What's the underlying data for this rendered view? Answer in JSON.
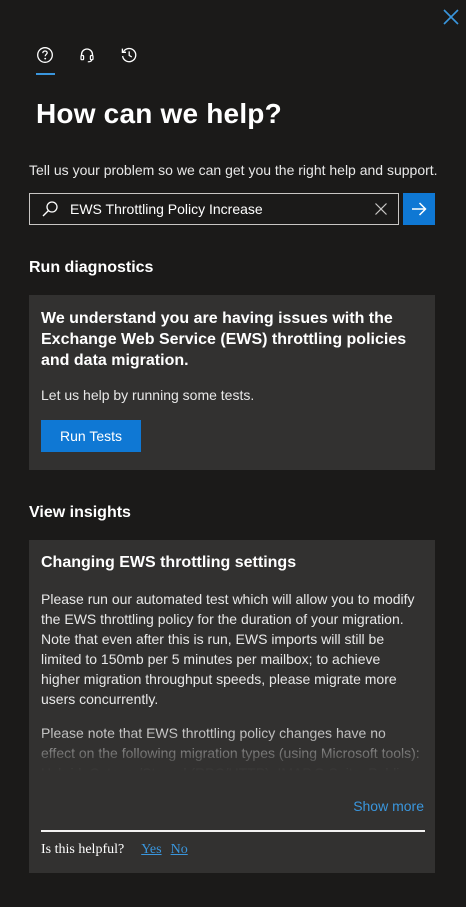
{
  "header": {
    "close_icon": "close-icon",
    "tabs": [
      {
        "icon": "help-circle-icon",
        "active": true
      },
      {
        "icon": "headset-icon",
        "active": false
      },
      {
        "icon": "history-icon",
        "active": false
      }
    ]
  },
  "title": "How can we help?",
  "subtitle": "Tell us your problem so we can get you the right help and support.",
  "search": {
    "value": "EWS Throttling Policy Increase",
    "icon": "search-icon",
    "clear_icon": "clear-icon",
    "submit_icon": "arrow-right-icon"
  },
  "diagnostics": {
    "heading": "Run diagnostics",
    "card_heading": "We understand you are having issues with the Exchange Web Service (EWS) throttling policies and data migration.",
    "card_text": "Let us help by running some tests.",
    "button_label": "Run Tests"
  },
  "insights": {
    "heading": "View insights",
    "card_heading": "Changing EWS throttling settings",
    "paragraphs": [
      "Please run our automated test which will allow you to modify the EWS throttling policy for the duration of your migration. Note that even after this is run, EWS imports will still be limited to 150mb per 5 minutes per mailbox; to achieve higher migration throughput speeds, please migrate more users concurrently.",
      "Please note that EWS throttling policy changes have no effect on the following migration types (using Microsoft tools): Hybrid, Cutover/Staged (RPC/HTTP), IMAP,G Suite, Public"
    ],
    "show_more": "Show more",
    "feedback_question": "Is this helpful?",
    "feedback_yes": "Yes",
    "feedback_no": "No"
  },
  "colors": {
    "background": "#1b1a19",
    "card": "#323130",
    "accent": "#0f78d4",
    "link": "#3a96dd"
  }
}
